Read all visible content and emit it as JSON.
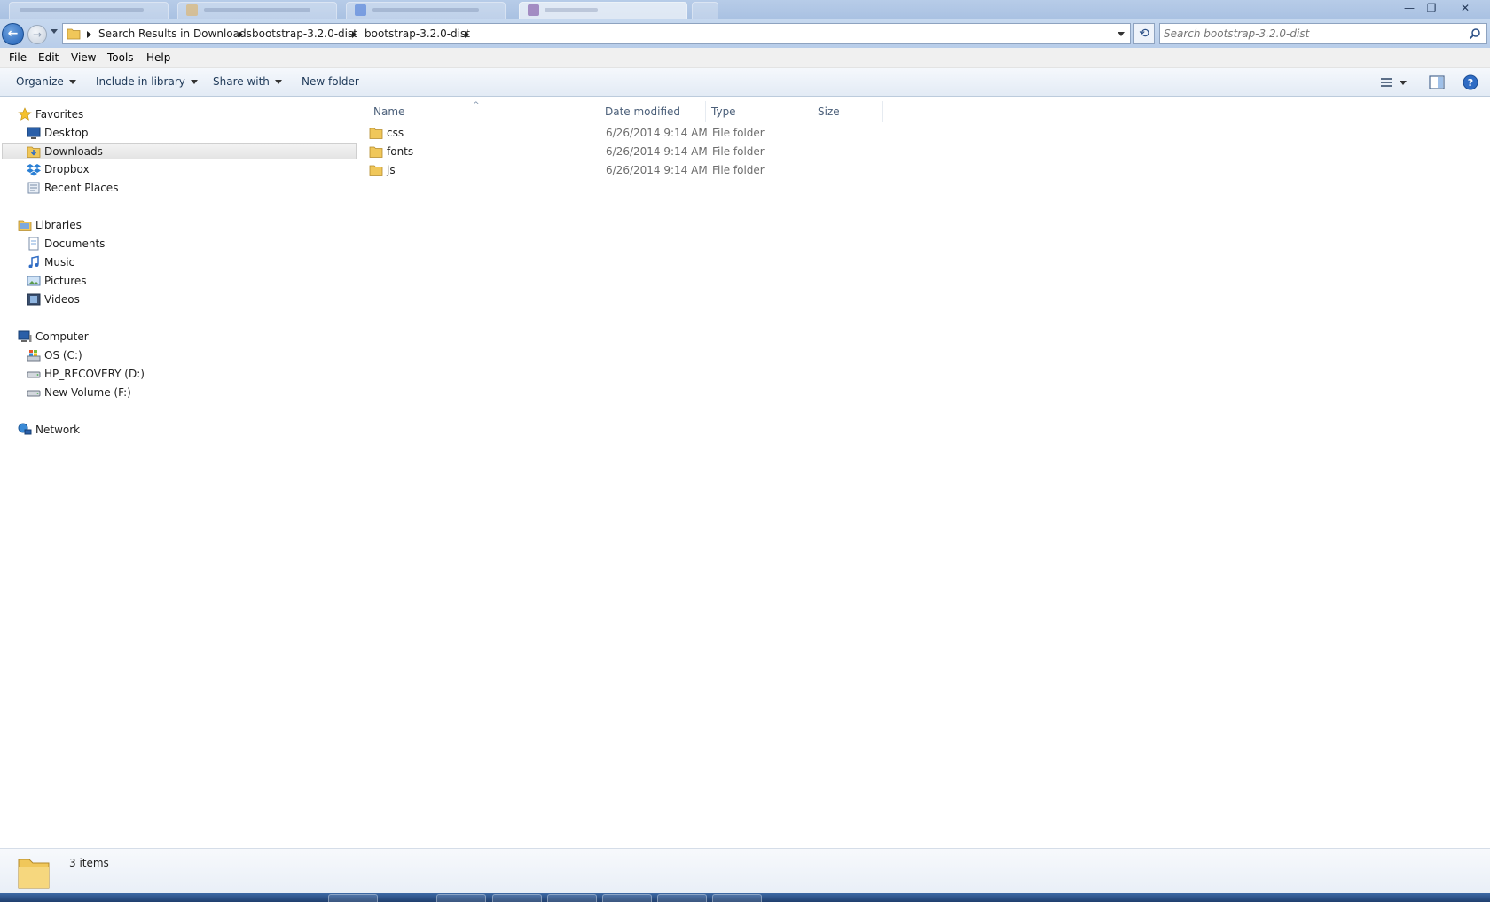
{
  "window": {
    "minimize_glyph": "—",
    "maximize_glyph": "❐",
    "close_glyph": "✕"
  },
  "navigation": {
    "back_glyph": "←",
    "forward_glyph": "→",
    "breadcrumbs": [
      "Search Results in Downloads",
      "bootstrap-3.2.0-dist",
      "bootstrap-3.2.0-dist"
    ],
    "refresh_glyph": "⟲"
  },
  "search": {
    "placeholder": "Search bootstrap-3.2.0-dist"
  },
  "menu": [
    "File",
    "Edit",
    "View",
    "Tools",
    "Help"
  ],
  "toolbar": {
    "organize": "Organize",
    "include_in_library": "Include in library",
    "share_with": "Share with",
    "new_folder": "New folder"
  },
  "nav_pane": {
    "favorites": {
      "label": "Favorites",
      "items": [
        "Desktop",
        "Downloads",
        "Dropbox",
        "Recent Places"
      ],
      "selected": "Downloads"
    },
    "libraries": {
      "label": "Libraries",
      "items": [
        "Documents",
        "Music",
        "Pictures",
        "Videos"
      ]
    },
    "computer": {
      "label": "Computer",
      "items": [
        "OS (C:)",
        "HP_RECOVERY (D:)",
        "New Volume (F:)"
      ]
    },
    "network": {
      "label": "Network"
    }
  },
  "columns": {
    "name": "Name",
    "date_modified": "Date modified",
    "type": "Type",
    "size": "Size"
  },
  "files": [
    {
      "name": "css",
      "date": "6/26/2014 9:14 AM",
      "type": "File folder",
      "size": ""
    },
    {
      "name": "fonts",
      "date": "6/26/2014 9:14 AM",
      "type": "File folder",
      "size": ""
    },
    {
      "name": "js",
      "date": "6/26/2014 9:14 AM",
      "type": "File folder",
      "size": ""
    }
  ],
  "status": {
    "items_count": "3 items"
  },
  "colors": {
    "title_bar": "#a9c1e2",
    "selection": "#e4e4e4",
    "folder": "#f0c75a"
  }
}
